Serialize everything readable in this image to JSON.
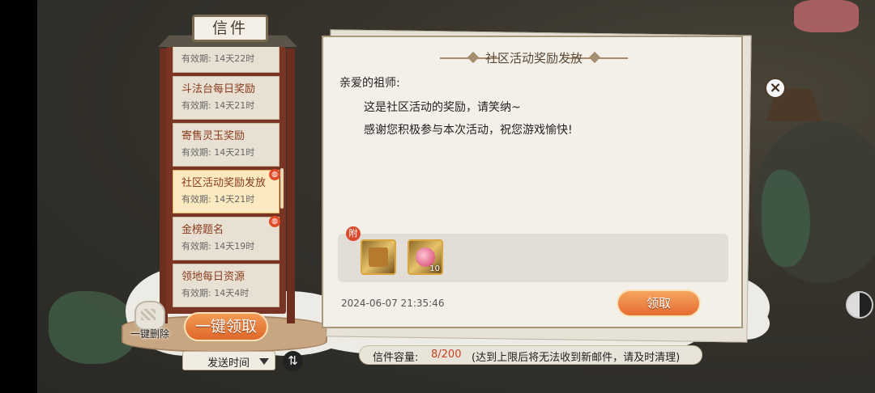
{
  "window": {
    "title": "信件"
  },
  "mail_list": {
    "items": [
      {
        "title": "",
        "expiry": "有效期: 14天22时",
        "selected": false,
        "has_attachment": false
      },
      {
        "title": "斗法台每日奖励",
        "expiry": "有效期: 14天21时",
        "selected": false,
        "has_attachment": false
      },
      {
        "title": "寄售灵玉奖励",
        "expiry": "有效期: 14天21时",
        "selected": false,
        "has_attachment": false
      },
      {
        "title": "社区活动奖励发放",
        "expiry": "有效期: 14天21时",
        "selected": true,
        "has_attachment": true
      },
      {
        "title": "金榜题名",
        "expiry": "有效期: 14天19时",
        "selected": false,
        "has_attachment": true
      },
      {
        "title": "领地每日资源",
        "expiry": "有效期: 14天4时",
        "selected": false,
        "has_attachment": false
      }
    ]
  },
  "actions": {
    "delete_all_label": "一键删除",
    "collect_all_label": "一键领取",
    "sort_label": "发送时间",
    "swap_icon": "⇅"
  },
  "letter": {
    "title": "社区活动奖励发放",
    "greeting": "亲爱的祖师:",
    "line1": "这是社区活动的奖励，请笑纳~",
    "line2": "感谢您积极参与本次活动，祝您游戏愉快!",
    "attachment_badge": "附",
    "attachments": [
      {
        "icon": "treasure-chest-icon",
        "count": ""
      },
      {
        "icon": "pink-orb-icon",
        "count": "10"
      }
    ],
    "timestamp": "2024-06-07 21:35:46",
    "claim_label": "领取"
  },
  "close_icon": "×",
  "capacity": {
    "label": "信件容量:",
    "value": "8/200",
    "note": "(达到上限后将无法收到新邮件，请及时清理)"
  },
  "colors": {
    "accent_orange": "#e46c2f",
    "title_red": "#8b3a1c",
    "count_red": "#c8401f"
  }
}
